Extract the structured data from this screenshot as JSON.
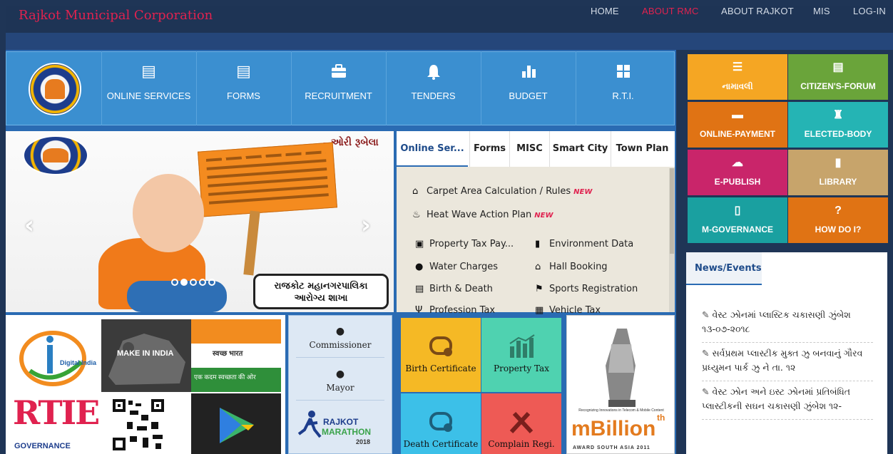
{
  "header": {
    "brand": "Rajkot Municipal Corporation",
    "nav": [
      "HOME",
      "ABOUT RMC",
      "ABOUT RAJKOT",
      "MIS",
      "LOG-IN"
    ]
  },
  "main_nav": [
    {
      "label": "ONLINE SERVICES",
      "icon": "list-icon"
    },
    {
      "label": "FORMS",
      "icon": "list-icon"
    },
    {
      "label": "RECRUITMENT",
      "icon": "briefcase-icon"
    },
    {
      "label": "TENDERS",
      "icon": "bell-icon"
    },
    {
      "label": "BUDGET",
      "icon": "bar-chart-icon"
    },
    {
      "label": "R.T.I.",
      "icon": "grid-icon"
    }
  ],
  "banner": {
    "brand_text": "ઓરી રૂબેલા",
    "caption_line1": "રાજકોટ મહાનગરપાલિકા",
    "caption_line2": "આરોગ્ય શાખા"
  },
  "tabs": [
    "Online Ser...",
    "Forms",
    "MISC",
    "Smart City",
    "Town Plan"
  ],
  "online_services": {
    "featured": [
      {
        "label": "Carpet Area Calculation / Rules",
        "badge": "NEW"
      },
      {
        "label": "Heat Wave Action Plan",
        "badge": "NEW"
      }
    ],
    "left": [
      "Property Tax Pay...",
      "Water Charges",
      "Birth & Death",
      "Profession Tax"
    ],
    "right": [
      "Environment Data",
      "Hall Booking",
      "Sports Registration",
      "Vehicle Tax"
    ]
  },
  "campaigns": {
    "digital_india": "Digital India",
    "make_in_india": "MAKE IN INDIA",
    "swachh_bharat": "स्वच्छ भारत",
    "swachh_tagline": "एक कदम स्वच्छता की ओर",
    "rtie": "RTIE",
    "governance": "GOVERNANCE"
  },
  "people": [
    "Commissioner",
    "Mayor"
  ],
  "marathon": {
    "line1": "RAJKOT",
    "line2": "MARATHON",
    "year": "2018"
  },
  "certificates": [
    {
      "label": "Birth Certificate",
      "color": "#f5b925"
    },
    {
      "label": "Property Tax",
      "color": "#4fd2b0"
    },
    {
      "label": "Death Certificate",
      "color": "#3cc0e8"
    },
    {
      "label": "Complain Regi.",
      "color": "#ee5a55"
    }
  ],
  "award": {
    "name": "mBillion",
    "sup": "th",
    "footer": "AWARD SOUTH ASIA 2011",
    "tagline": "Recognizing Innovations in Telecom & Mobile Content"
  },
  "right_tiles": [
    {
      "label": "નામાવલી",
      "color": "#f5a623",
      "icon": "list-icon"
    },
    {
      "label": "CITIZEN'S-FORUM",
      "color": "#6aa43a",
      "icon": "document-icon"
    },
    {
      "label": "ONLINE-PAYMENT",
      "color": "#e07314",
      "icon": "card-icon"
    },
    {
      "label": "ELECTED-BODY",
      "color": "#25b4b4",
      "icon": "chess-icon"
    },
    {
      "label": "E-PUBLISH",
      "color": "#c9256a",
      "icon": "upload-icon"
    },
    {
      "label": "LIBRARY",
      "color": "#c7a46b",
      "icon": "book-icon"
    },
    {
      "label": "M-GOVERNANCE",
      "color": "#1aa0a0",
      "icon": "mobile-icon"
    },
    {
      "label": "HOW DO I?",
      "color": "#e07314",
      "icon": "help-icon"
    }
  ],
  "news": {
    "tab": "News/Events",
    "items": [
      "વેસ્ટ ઝોનમાં પ્લાસ્ટિક ચકાસણી ઝુંબેશ ૧૩-૦૭-૨૦૧૮",
      "સર્વપ્રથમ પ્લાસ્ટીક મુક્ત ઝુ બનવાનું ગૌરવ પ્રધ્યુમન પાર્ક ઝુ ને તા. ૧૨",
      "વેસ્ટ ઝોન અને ઇસ્ટ ઝોનમાં પ્રતિબંધિત પ્લાસ્ટીકની સઘન ચકાસણી ઝુંબેશ ૧૨-"
    ]
  }
}
